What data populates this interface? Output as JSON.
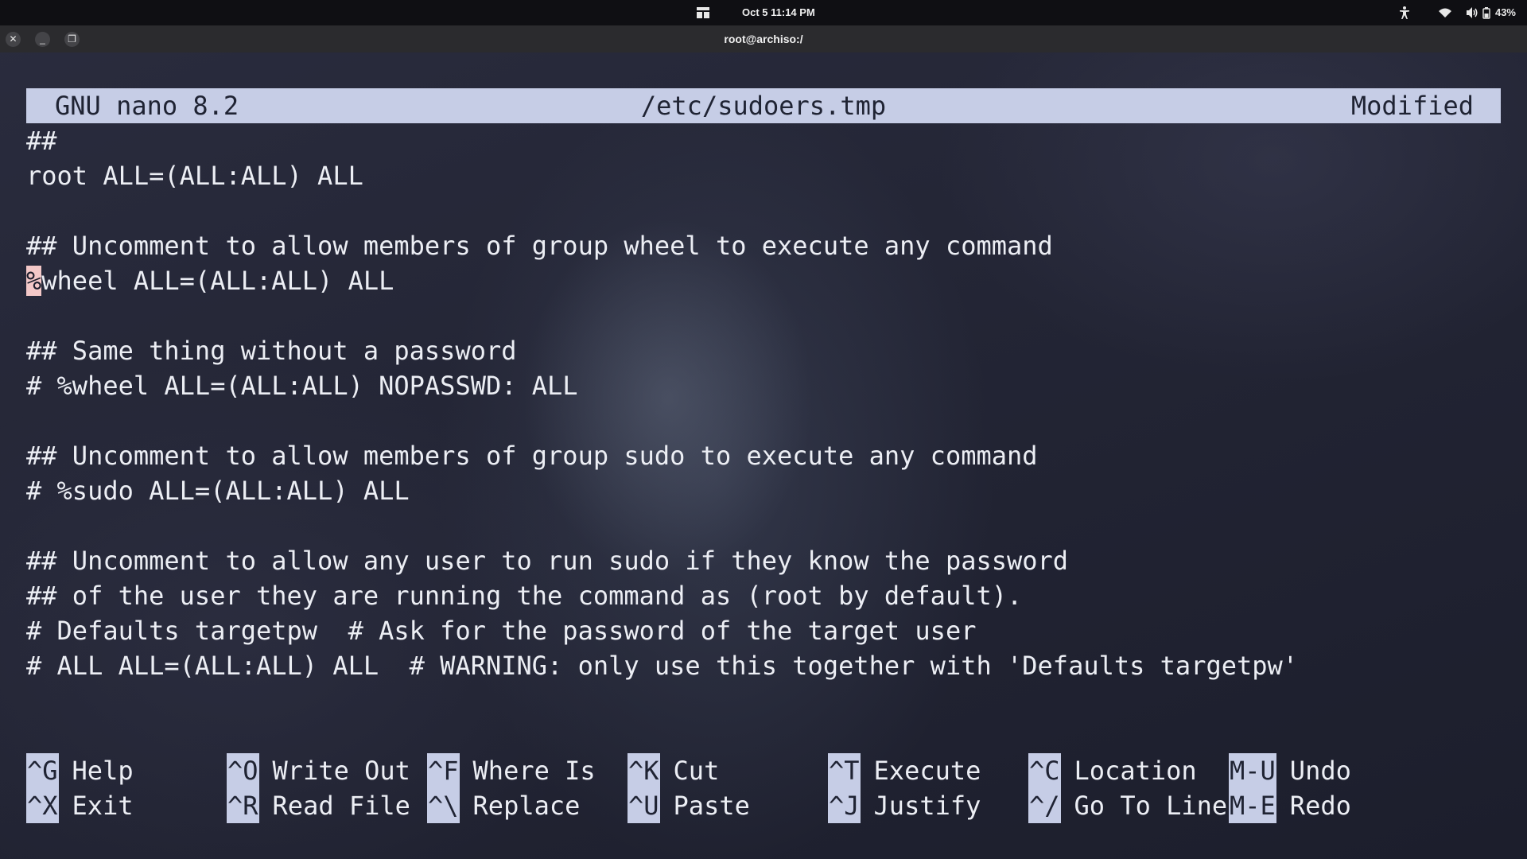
{
  "topbar": {
    "clock": "Oct 5  11:14 PM",
    "battery_percent": "43%",
    "icons": [
      "activities-icon",
      "accessibility-icon",
      "wifi-icon",
      "volume-icon",
      "battery-icon"
    ]
  },
  "window": {
    "title": "root@archiso:/",
    "buttons": [
      "close-icon",
      "minimize-icon",
      "restore-icon"
    ]
  },
  "nano": {
    "version": "GNU nano 8.2",
    "filename": "/etc/sudoers.tmp",
    "status": "Modified",
    "cursor_char": "%",
    "lines": [
      "##",
      "root ALL=(ALL:ALL) ALL",
      "",
      "## Uncomment to allow members of group wheel to execute any command",
      "wheel ALL=(ALL:ALL) ALL",
      "",
      "## Same thing without a password",
      "# %wheel ALL=(ALL:ALL) NOPASSWD: ALL",
      "",
      "## Uncomment to allow members of group sudo to execute any command",
      "# %sudo ALL=(ALL:ALL) ALL",
      "",
      "## Uncomment to allow any user to run sudo if they know the password",
      "## of the user they are running the command as (root by default).",
      "# Defaults targetpw  # Ask for the password of the target user",
      "# ALL ALL=(ALL:ALL) ALL  # WARNING: only use this together with 'Defaults targetpw'"
    ],
    "shortcuts": [
      {
        "key": "^G",
        "label": "Help"
      },
      {
        "key": "^X",
        "label": "Exit"
      },
      {
        "key": "^O",
        "label": "Write Out"
      },
      {
        "key": "^R",
        "label": "Read File"
      },
      {
        "key": "^F",
        "label": "Where Is"
      },
      {
        "key": "^\\",
        "label": "Replace"
      },
      {
        "key": "^K",
        "label": "Cut"
      },
      {
        "key": "^U",
        "label": "Paste"
      },
      {
        "key": "^T",
        "label": "Execute"
      },
      {
        "key": "^J",
        "label": "Justify"
      },
      {
        "key": "^C",
        "label": "Location"
      },
      {
        "key": "^/",
        "label": "Go To Line"
      },
      {
        "key": "M-U",
        "label": "Undo"
      },
      {
        "key": "M-E",
        "label": "Redo"
      }
    ]
  }
}
